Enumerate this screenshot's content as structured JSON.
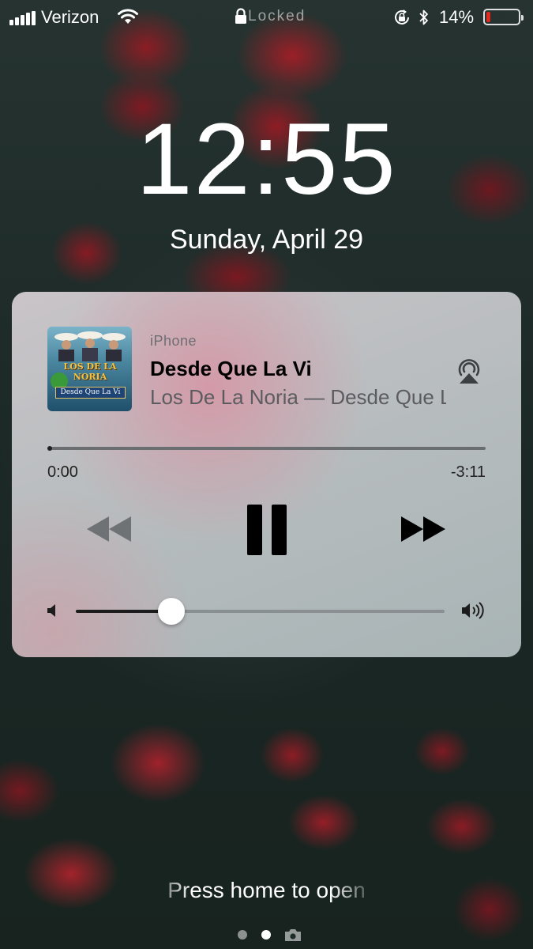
{
  "status_bar": {
    "carrier": "Verizon",
    "lock_text": "Locked",
    "battery_percent": "14%",
    "battery_level": 0.14,
    "battery_color": "#e0281e",
    "icons": [
      "signal-bars-icon",
      "wifi-icon",
      "padlock-icon",
      "rotation-lock-icon",
      "bluetooth-icon",
      "battery-icon"
    ]
  },
  "lock_screen": {
    "time": "12:55",
    "date": "Sunday, April 29",
    "press_home": "Press home to open",
    "page_indicator": {
      "count": 2,
      "active": 1,
      "extra_icon": "camera-icon"
    }
  },
  "now_playing": {
    "source": "iPhone",
    "title": "Desde Que La Vi",
    "subtitle": "Los De La Noria — Desde Que La Vi",
    "album_art": {
      "band_text": "LOS DE LA NORIA",
      "album_text": "Desde Que La Vi"
    },
    "elapsed": "0:00",
    "remaining": "-3:11",
    "progress": 0.0,
    "volume": 0.26,
    "controls": [
      "rewind-icon",
      "pause-icon",
      "fast-forward-icon"
    ],
    "airplay_icon": "airplay-icon"
  }
}
